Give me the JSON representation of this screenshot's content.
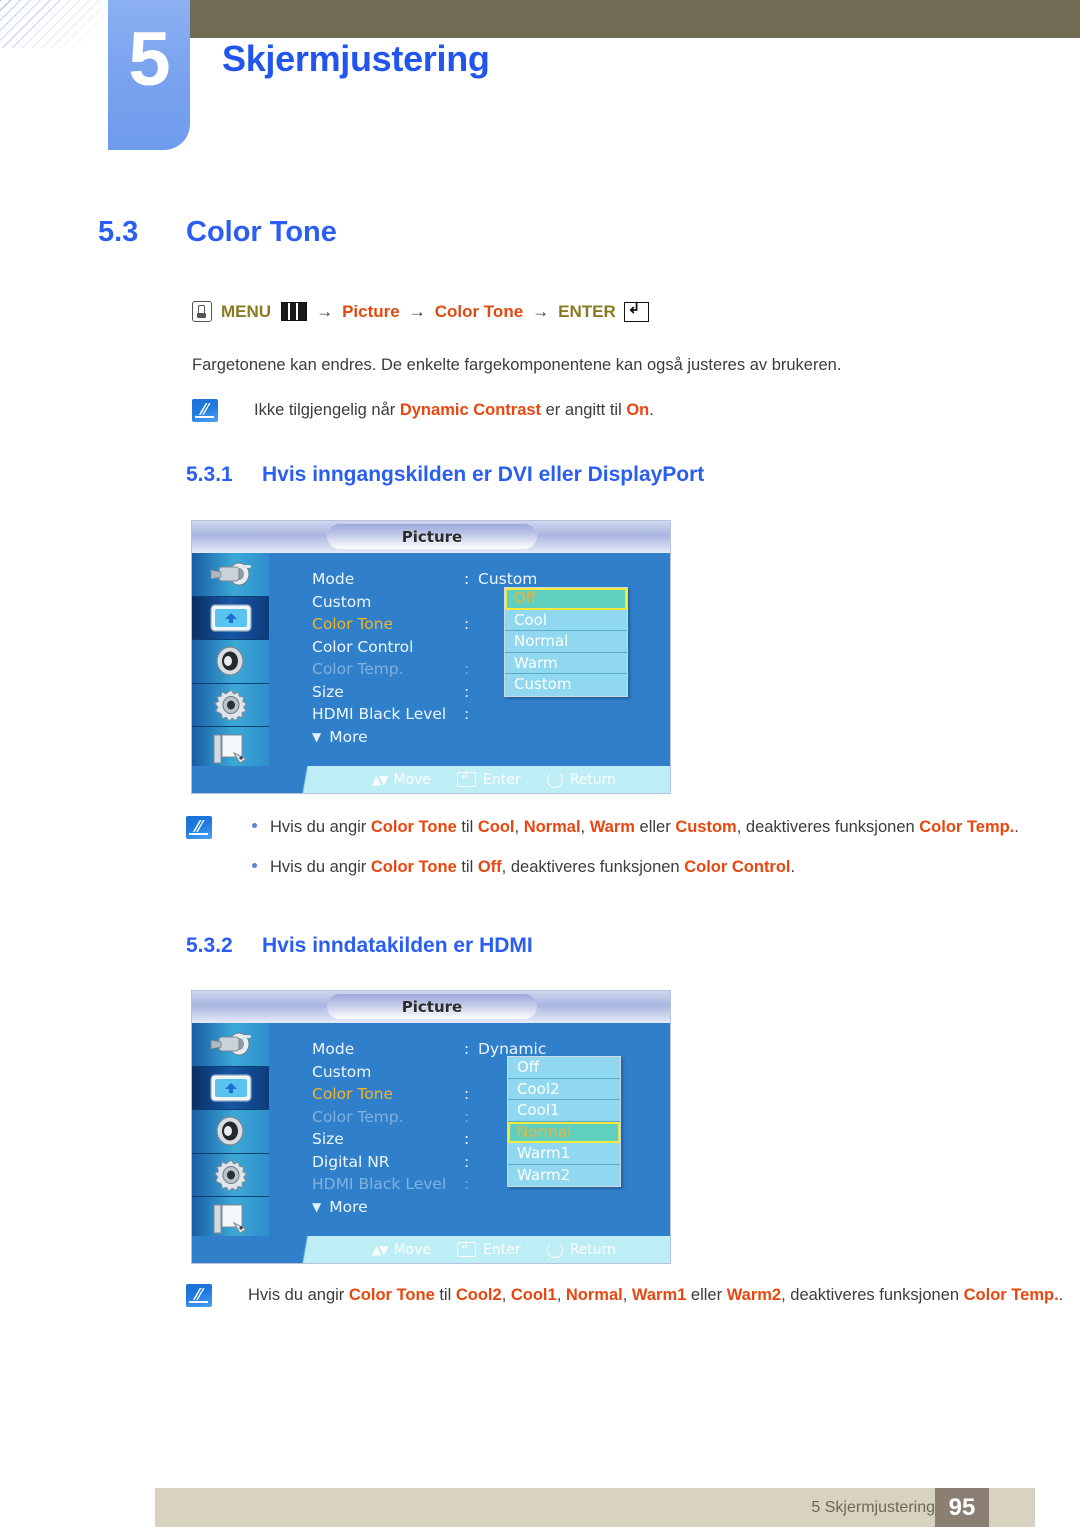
{
  "header": {
    "chapter_number": "5",
    "chapter_title": "Skjermjustering"
  },
  "section": {
    "number": "5.3",
    "title": "Color Tone"
  },
  "breadcrumb": {
    "menu_label": "MENU",
    "arrow": "→",
    "picture_label": "Picture",
    "color_tone_label": "Color Tone",
    "enter_label": "ENTER",
    "icons": {
      "hand": "hand-pointer-icon",
      "keypad": "menu-keypad-icon",
      "enter_key": "enter-key-icon"
    }
  },
  "intro_paragraph": "Fargetonene kan endres. De enkelte fargekomponentene kan også justeres av brukeren.",
  "note_1": {
    "prefix": "Ikke tilgjengelig når ",
    "highlight_1": "Dynamic Contrast",
    "middle": " er angitt til ",
    "highlight_2": "On",
    "suffix": "."
  },
  "subsection_1": {
    "number": "5.3.1",
    "title": "Hvis inngangskilden er DVI eller DisplayPort"
  },
  "osd_1": {
    "title": "Picture",
    "sidebar_icons": [
      "input-source-icon",
      "picture-icon",
      "sound-icon",
      "setup-gear-icon",
      "multi-control-icon"
    ],
    "selected_sidebar_index": 1,
    "rows": [
      {
        "label": "Mode",
        "colon": ":",
        "value": "Custom",
        "state": "normal"
      },
      {
        "label": "Custom",
        "colon": "",
        "value": "",
        "state": "normal"
      },
      {
        "label": "Color Tone",
        "colon": ":",
        "value": "",
        "state": "active"
      },
      {
        "label": "Color Control",
        "colon": "",
        "value": "",
        "state": "normal"
      },
      {
        "label": "Color Temp.",
        "colon": ":",
        "value": "",
        "state": "dim"
      },
      {
        "label": "Size",
        "colon": ":",
        "value": "",
        "state": "normal"
      },
      {
        "label": "HDMI Black Level",
        "colon": ":",
        "value": "",
        "state": "normal"
      }
    ],
    "more_label": "More",
    "dropdown": {
      "items": [
        "Off",
        "Cool",
        "Normal",
        "Warm",
        "Custom"
      ],
      "selected_index": 0
    },
    "footer": {
      "move": "Move",
      "enter": "Enter",
      "return": "Return"
    }
  },
  "bullets_1": [
    {
      "parts": [
        {
          "t": "Hvis du angir ",
          "hl": false
        },
        {
          "t": "Color Tone",
          "hl": true
        },
        {
          "t": " til ",
          "hl": false
        },
        {
          "t": "Cool",
          "hl": true
        },
        {
          "t": ", ",
          "hl": false
        },
        {
          "t": "Normal",
          "hl": true
        },
        {
          "t": ", ",
          "hl": false
        },
        {
          "t": "Warm",
          "hl": true
        },
        {
          "t": " eller ",
          "hl": false
        },
        {
          "t": "Custom",
          "hl": true
        },
        {
          "t": ", deaktiveres funksjonen ",
          "hl": false
        },
        {
          "t": "Color Temp.",
          "hl": true
        },
        {
          "t": ".",
          "hl": false
        }
      ]
    },
    {
      "parts": [
        {
          "t": "Hvis du angir ",
          "hl": false
        },
        {
          "t": "Color Tone",
          "hl": true
        },
        {
          "t": " til ",
          "hl": false
        },
        {
          "t": "Off",
          "hl": true
        },
        {
          "t": ", deaktiveres funksjonen ",
          "hl": false
        },
        {
          "t": "Color Control",
          "hl": true
        },
        {
          "t": ".",
          "hl": false
        }
      ]
    }
  ],
  "subsection_2": {
    "number": "5.3.2",
    "title": "Hvis inndatakilden er HDMI"
  },
  "osd_2": {
    "title": "Picture",
    "sidebar_icons": [
      "input-source-icon",
      "picture-icon",
      "sound-icon",
      "setup-gear-icon",
      "multi-control-icon"
    ],
    "selected_sidebar_index": 1,
    "rows": [
      {
        "label": "Mode",
        "colon": ":",
        "value": "Dynamic",
        "state": "normal"
      },
      {
        "label": "Custom",
        "colon": "",
        "value": "",
        "state": "normal"
      },
      {
        "label": "Color Tone",
        "colon": ":",
        "value": "",
        "state": "active"
      },
      {
        "label": "Color Temp.",
        "colon": ":",
        "value": "",
        "state": "dim"
      },
      {
        "label": "Size",
        "colon": ":",
        "value": "",
        "state": "normal"
      },
      {
        "label": "Digital NR",
        "colon": ":",
        "value": "",
        "state": "normal"
      },
      {
        "label": "HDMI Black Level",
        "colon": ":",
        "value": "",
        "state": "dim"
      }
    ],
    "more_label": "More",
    "dropdown": {
      "items": [
        "Off",
        "Cool2",
        "Cool1",
        "Normal",
        "Warm1",
        "Warm2"
      ],
      "selected_index": 3
    },
    "footer": {
      "move": "Move",
      "enter": "Enter",
      "return": "Return"
    }
  },
  "note_3": {
    "parts": [
      {
        "t": "Hvis du angir ",
        "hl": false
      },
      {
        "t": "Color Tone",
        "hl": true
      },
      {
        "t": " til ",
        "hl": false
      },
      {
        "t": "Cool2",
        "hl": true
      },
      {
        "t": ", ",
        "hl": false
      },
      {
        "t": "Cool1",
        "hl": true
      },
      {
        "t": ", ",
        "hl": false
      },
      {
        "t": "Normal",
        "hl": true
      },
      {
        "t": ", ",
        "hl": false
      },
      {
        "t": "Warm1",
        "hl": true
      },
      {
        "t": " eller ",
        "hl": false
      },
      {
        "t": "Warm2",
        "hl": true
      },
      {
        "t": ", deaktiveres funksjonen ",
        "hl": false
      },
      {
        "t": "Color Temp.",
        "hl": true
      },
      {
        "t": ".",
        "hl": false
      }
    ]
  },
  "footer": {
    "label": "5 Skjermjustering",
    "page": "95"
  },
  "colors": {
    "heading_blue": "#2a5ef0",
    "highlight_orange": "#e8470f",
    "olive_bar": "#706b52",
    "footer_bar": "#d8d3c0",
    "page_box": "#8a7f72",
    "osd_blue": "#2f7fcb",
    "osd_dropdown": "#8fd8ef",
    "osd_selected": "#5fcfc0"
  }
}
